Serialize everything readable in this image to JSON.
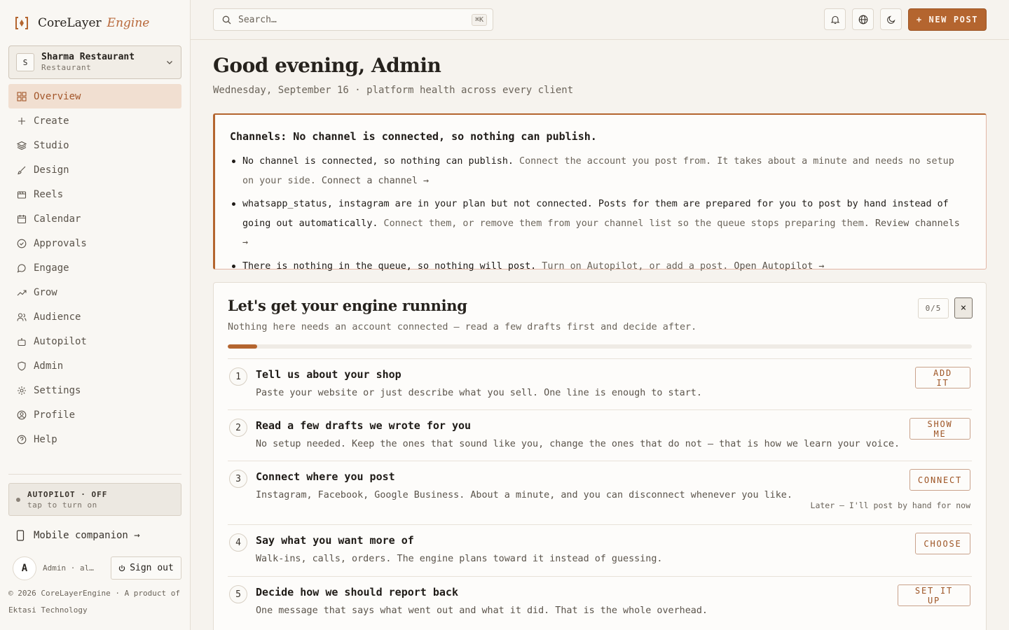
{
  "brand": {
    "name": "CoreLayer",
    "suffix": "Engine",
    "accent": "#b4652f"
  },
  "workspace": {
    "initial": "S",
    "name": "Sharma Restaurant",
    "type": "Restaurant"
  },
  "nav": [
    {
      "label": "Overview",
      "icon": "grid-icon",
      "active": true
    },
    {
      "label": "Create",
      "icon": "plus-icon"
    },
    {
      "label": "Studio",
      "icon": "layers-icon"
    },
    {
      "label": "Design",
      "icon": "brush-icon"
    },
    {
      "label": "Reels",
      "icon": "film-icon"
    },
    {
      "label": "Calendar",
      "icon": "calendar-icon"
    },
    {
      "label": "Approvals",
      "icon": "check-circle-icon"
    },
    {
      "label": "Engage",
      "icon": "chat-icon"
    },
    {
      "label": "Grow",
      "icon": "trend-up-icon"
    },
    {
      "label": "Audience",
      "icon": "users-icon"
    },
    {
      "label": "Autopilot",
      "icon": "robot-icon"
    },
    {
      "label": "Admin",
      "icon": "shield-icon"
    },
    {
      "label": "Settings",
      "icon": "gear-icon"
    },
    {
      "label": "Profile",
      "icon": "user-circle-icon"
    },
    {
      "label": "Help",
      "icon": "help-icon"
    }
  ],
  "autopilot": {
    "title": "AUTOPILOT · OFF",
    "subtitle": "tap to turn on"
  },
  "mobile": {
    "label": "Mobile companion →"
  },
  "user": {
    "initial": "A",
    "name": "Admin · al…",
    "signout": "Sign out"
  },
  "copyright": "© 2026 CoreLayerEngine · A product of Ektasi Technology",
  "topbar": {
    "search_placeholder": "Search…",
    "shortcut": "⌘K",
    "new_post": "+ NEW POST"
  },
  "greeting": {
    "title": "Good evening, Admin",
    "subtitle": "Wednesday, September 16 · platform health across every client"
  },
  "alert": {
    "title": "Channels: No channel is connected, so nothing can publish.",
    "items": [
      {
        "strong": "No channel is connected, so nothing can publish.",
        "muted": "Connect the account you post from. It takes about a minute and needs no setup on your side.",
        "link": "Connect a channel →"
      },
      {
        "strong": "whatsapp_status, instagram are in your plan but not connected. Posts for them are prepared for you to post by hand instead of going out automatically.",
        "muted": "Connect them, or remove them from your channel list so the queue stops preparing them.",
        "link": "Review channels →"
      },
      {
        "strong": "There is nothing in the queue, so nothing will post.",
        "muted": "Turn on Autopilot, or add a post.",
        "link": "Open Autopilot →"
      }
    ]
  },
  "setup": {
    "title": "Let's get your engine running",
    "subtitle": "Nothing here needs an account connected — read a few drafts first and decide after.",
    "counter": "0/5",
    "progress": 0.04,
    "close": "×",
    "steps": [
      {
        "num": "1",
        "title": "Tell us about your shop",
        "desc": "Paste your website or just describe what you sell. One line is enough to start.",
        "action": "ADD IT"
      },
      {
        "num": "2",
        "title": "Read a few drafts we wrote for you",
        "desc": "No setup needed. Keep the ones that sound like you, change the ones that do not — that is how we learn your voice.",
        "action": "SHOW ME"
      },
      {
        "num": "3",
        "title": "Connect where you post",
        "desc": "Instagram, Facebook, Google Business. About a minute, and you can disconnect whenever you like.",
        "action": "CONNECT",
        "later": "Later — I'll post by hand for now"
      },
      {
        "num": "4",
        "title": "Say what you want more of",
        "desc": "Walk-ins, calls, orders. The engine plans toward it instead of guessing.",
        "action": "CHOOSE"
      },
      {
        "num": "5",
        "title": "Decide how we should report back",
        "desc": "One message that says what went out and what it did. That is the whole overhead.",
        "action": "SET IT UP"
      }
    ]
  }
}
